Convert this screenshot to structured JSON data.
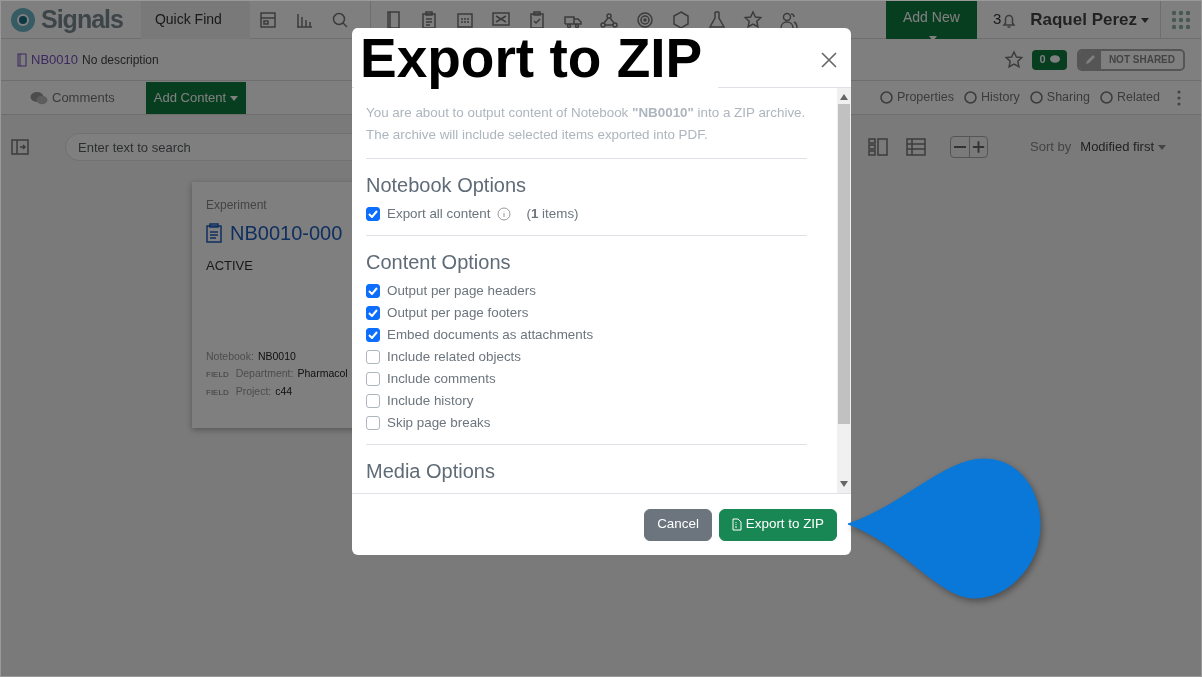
{
  "app": {
    "logo": "Signals",
    "quick_find": "Quick Find",
    "add_new": "Add New",
    "notification_count": "3",
    "user": "Raquel Perez"
  },
  "notebook": {
    "id": "NB0010",
    "description": "No description",
    "comment_count": "0",
    "sharing": "NOT SHARED"
  },
  "toolbar": {
    "comments": "Comments",
    "add_content": "Add Content",
    "links": [
      "Properties",
      "History",
      "Sharing",
      "Related"
    ]
  },
  "filter": {
    "placeholder": "Enter text to search",
    "sort_label": "Sort by",
    "sort_value": "Modified first"
  },
  "card": {
    "type": "Experiment",
    "title": "NB0010-000",
    "status": "ACTIVE",
    "fields": [
      {
        "label": "Notebook:",
        "value": "NB0010"
      },
      {
        "tag": "FIELD",
        "label": "Department:",
        "value": "Pharmacol"
      },
      {
        "tag": "FIELD",
        "label": "Project:",
        "value": "c44"
      }
    ]
  },
  "modal": {
    "title": "Export to ZIP",
    "intro": "You are about to output content of Notebook **\"NB0010\"** into a ZIP archive. The archive will include selected items exported into PDF.",
    "sections": [
      {
        "heading": "Notebook Options",
        "options": [
          {
            "label": "Export all content",
            "checked": true,
            "info": true,
            "count": "(**1** items)"
          }
        ]
      },
      {
        "heading": "Content Options",
        "options": [
          {
            "label": "Output per page headers",
            "checked": true
          },
          {
            "label": "Output per page footers",
            "checked": true
          },
          {
            "label": "Embed documents as attachments",
            "checked": true
          },
          {
            "label": "Include related objects",
            "checked": false
          },
          {
            "label": "Include comments",
            "checked": false
          },
          {
            "label": "Include history",
            "checked": false
          },
          {
            "label": "Skip page breaks",
            "checked": false
          }
        ]
      },
      {
        "heading": "Media Options"
      }
    ],
    "buttons": [
      {
        "label": "Cancel",
        "kind": "secondary"
      },
      {
        "label": "Export to ZIP",
        "kind": "primary"
      }
    ]
  }
}
